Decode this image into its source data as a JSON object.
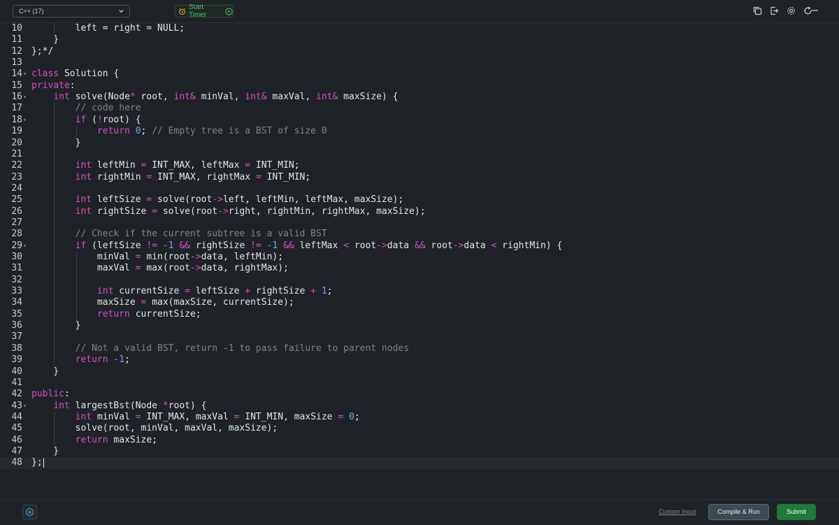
{
  "toolbar": {
    "language": "C++ (17)",
    "start_timer": "Start Timer",
    "icons": [
      "copy-icon",
      "export-icon",
      "settings-icon",
      "reset-icon"
    ]
  },
  "editor": {
    "lines": [
      {
        "n": "10",
        "html": "        left = right = NULL;"
      },
      {
        "n": "11",
        "html": "    }"
      },
      {
        "n": "12",
        "html": "};*/"
      },
      {
        "n": "13",
        "html": ""
      },
      {
        "n": "14",
        "html": "<span class=\"kw\">class</span> Solution {"
      },
      {
        "n": "15",
        "html": "<span class=\"kw\">private</span>:"
      },
      {
        "n": "16",
        "html": "    <span class=\"tp\">int</span> solve(Node<span class=\"op\">*</span> root, <span class=\"tp\">int</span><span class=\"op\">&amp;</span> minVal, <span class=\"tp\">int</span><span class=\"op\">&amp;</span> maxVal, <span class=\"tp\">int</span><span class=\"op\">&amp;</span> maxSize) {"
      },
      {
        "n": "17",
        "html": "        <span class=\"cm\">// code here</span>"
      },
      {
        "n": "18",
        "html": "        <span class=\"kw\">if</span> (<span class=\"op\">!</span>root) {"
      },
      {
        "n": "19",
        "html": "            <span class=\"kw\">return</span> <span class=\"num\">0</span>; <span class=\"cm\">// Empty tree is a BST of size 0</span>"
      },
      {
        "n": "20",
        "html": "        }"
      },
      {
        "n": "21",
        "html": ""
      },
      {
        "n": "22",
        "html": "        <span class=\"tp\">int</span> leftMin <span class=\"op\">=</span> INT_MAX, leftMax <span class=\"op\">=</span> INT_MIN;"
      },
      {
        "n": "23",
        "html": "        <span class=\"tp\">int</span> rightMin <span class=\"op\">=</span> INT_MAX, rightMax <span class=\"op\">=</span> INT_MIN;"
      },
      {
        "n": "24",
        "html": ""
      },
      {
        "n": "25",
        "html": "        <span class=\"tp\">int</span> leftSize <span class=\"op\">=</span> solve(root<span class=\"op\">-&gt;</span>left, leftMin, leftMax, maxSize);"
      },
      {
        "n": "26",
        "html": "        <span class=\"tp\">int</span> rightSize <span class=\"op\">=</span> solve(root<span class=\"op\">-&gt;</span>right, rightMin, rightMax, maxSize);"
      },
      {
        "n": "27",
        "html": ""
      },
      {
        "n": "28",
        "html": "        <span class=\"cm\">// Check if the current subtree is a valid BST</span>"
      },
      {
        "n": "29",
        "html": "        <span class=\"kw\">if</span> (leftSize <span class=\"op\">!=</span> <span class=\"num\">-1</span> <span class=\"op\">&amp;&amp;</span> rightSize <span class=\"op\">!=</span> <span class=\"num\">-1</span> <span class=\"op\">&amp;&amp;</span> leftMax <span class=\"op\">&lt;</span> root<span class=\"op\">-&gt;</span>data <span class=\"op\">&amp;&amp;</span> root<span class=\"op\">-&gt;</span>data <span class=\"op\">&lt;</span> rightMin) {"
      },
      {
        "n": "30",
        "html": "            minVal <span class=\"op\">=</span> min(root<span class=\"op\">-&gt;</span>data, leftMin);"
      },
      {
        "n": "31",
        "html": "            maxVal <span class=\"op\">=</span> max(root<span class=\"op\">-&gt;</span>data, rightMax);"
      },
      {
        "n": "32",
        "html": ""
      },
      {
        "n": "33",
        "html": "            <span class=\"tp\">int</span> currentSize <span class=\"op\">=</span> leftSize <span class=\"op\">+</span> rightSize <span class=\"op\">+</span> <span class=\"num\">1</span>;"
      },
      {
        "n": "34",
        "html": "            maxSize <span class=\"op\">=</span> max(maxSize, currentSize);"
      },
      {
        "n": "35",
        "html": "            <span class=\"kw\">return</span> currentSize;"
      },
      {
        "n": "36",
        "html": "        }"
      },
      {
        "n": "37",
        "html": ""
      },
      {
        "n": "38",
        "html": "        <span class=\"cm\">// Not a valid BST, return -1 to pass failure to parent nodes</span>"
      },
      {
        "n": "39",
        "html": "        <span class=\"kw\">return</span> <span class=\"num\">-1</span>;"
      },
      {
        "n": "40",
        "html": "    }"
      },
      {
        "n": "41",
        "html": ""
      },
      {
        "n": "42",
        "html": "<span class=\"kw\">public</span>:"
      },
      {
        "n": "43",
        "html": "    <span class=\"tp\">int</span> largestBst(Node <span class=\"op\">*</span>root) {"
      },
      {
        "n": "44",
        "html": "        <span class=\"tp\">int</span> minVal <span class=\"op\">=</span> INT_MAX, maxVal <span class=\"op\">=</span> INT_MIN, maxSize <span class=\"op\">=</span> <span class=\"num\">0</span>;"
      },
      {
        "n": "45",
        "html": "        solve(root, minVal, maxVal, maxSize);"
      },
      {
        "n": "46",
        "html": "        <span class=\"kw\">return</span> maxSize;"
      },
      {
        "n": "47",
        "html": "    }"
      },
      {
        "n": "48",
        "html": "};"
      }
    ],
    "fold_lines": [
      "14",
      "16",
      "18",
      "29",
      "43"
    ],
    "active_line": "48"
  },
  "bottom": {
    "custom_input": "Custom Input",
    "compile_run": "Compile & Run",
    "submit": "Submit"
  },
  "colors": {
    "background": "#1f2327",
    "keyword": "#d04fc4",
    "number": "#6aa3ff",
    "comment": "#7d8388",
    "timer_accent": "#4fbf6f",
    "submit": "#1f7a3c"
  }
}
